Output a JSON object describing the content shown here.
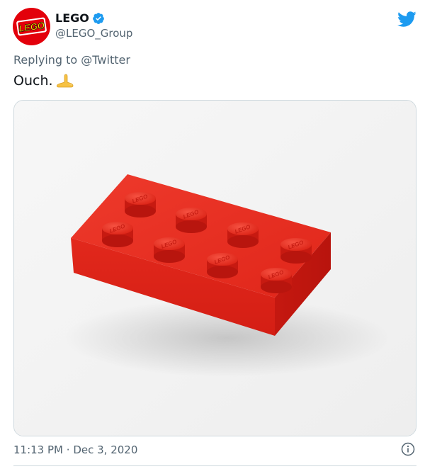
{
  "author": {
    "display_name": "LEGO",
    "handle": "@LEGO_Group",
    "verified": true,
    "avatar_text": "LEGO"
  },
  "reply": {
    "prefix": "Replying to",
    "mention": "@Twitter"
  },
  "tweet": {
    "text": "Ouch.",
    "emoji": "foot-emoji"
  },
  "media": {
    "stud_label": "LEGO",
    "description_icon": "lego-brick-photo"
  },
  "meta": {
    "time": "11:13 PM",
    "separator": "·",
    "date": "Dec 3, 2020"
  },
  "icons": {
    "platform": "twitter-bird-icon",
    "info": "info-icon"
  },
  "colors": {
    "twitter_blue": "#1d9bf0",
    "lego_red": "#e3000b",
    "brick_red": "#e4261c"
  }
}
